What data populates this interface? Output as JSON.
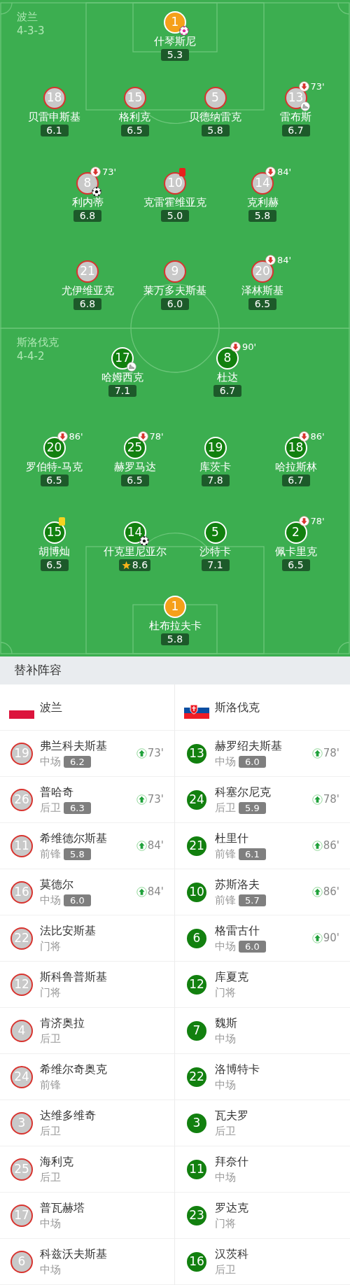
{
  "pitch": {
    "teams": [
      {
        "name": "波兰",
        "formation": "4-3-3",
        "kind": "home",
        "lines": [
          [
            {
              "number": "1",
              "name": "什琴斯尼",
              "rating": "5.3",
              "kind": "goalkeeper",
              "best": false,
              "events": [
                {
                  "kind": "own_goal"
                }
              ]
            }
          ],
          [
            {
              "number": "18",
              "name": "贝雷申斯基",
              "rating": "6.1",
              "kind": "outfield",
              "best": false
            },
            {
              "number": "15",
              "name": "格利克",
              "rating": "6.5",
              "kind": "outfield",
              "best": false
            },
            {
              "number": "5",
              "name": "贝德纳雷克",
              "rating": "5.8",
              "kind": "outfield",
              "best": false
            },
            {
              "number": "13",
              "name": "雷布斯",
              "rating": "6.7",
              "kind": "outfield",
              "best": false,
              "events": [
                {
                  "kind": "sub_off",
                  "minute": "73'"
                },
                {
                  "kind": "assist"
                }
              ]
            }
          ],
          [
            {
              "number": "8",
              "name": "利内蒂",
              "rating": "6.8",
              "kind": "outfield",
              "best": false,
              "events": [
                {
                  "kind": "sub_off",
                  "minute": "73'"
                },
                {
                  "kind": "goal"
                }
              ]
            },
            {
              "number": "10",
              "name": "克雷霍维亚克",
              "rating": "5.0",
              "kind": "outfield",
              "best": false,
              "events": [
                {
                  "kind": "red_card"
                }
              ]
            },
            {
              "number": "14",
              "name": "克利赫",
              "rating": "5.8",
              "kind": "outfield",
              "best": false,
              "events": [
                {
                  "kind": "sub_off",
                  "minute": "84'"
                }
              ]
            }
          ],
          [
            {
              "number": "21",
              "name": "尤伊维亚克",
              "rating": "6.8",
              "kind": "outfield",
              "best": false
            },
            {
              "number": "9",
              "name": "莱万多夫斯基",
              "rating": "6.0",
              "kind": "outfield",
              "best": false
            },
            {
              "number": "20",
              "name": "泽林斯基",
              "rating": "6.5",
              "kind": "outfield",
              "best": false,
              "events": [
                {
                  "kind": "sub_off",
                  "minute": "84'"
                }
              ]
            }
          ]
        ]
      },
      {
        "name": "斯洛伐克",
        "formation": "4-4-2",
        "kind": "away",
        "lines": [
          [
            {
              "number": "17",
              "name": "哈姆西克",
              "rating": "7.1",
              "kind": "outfield",
              "best": false,
              "events": [
                {
                  "kind": "assist"
                }
              ]
            },
            {
              "number": "8",
              "name": "杜达",
              "rating": "6.7",
              "kind": "outfield",
              "best": false,
              "events": [
                {
                  "kind": "sub_off",
                  "minute": "90'"
                }
              ]
            }
          ],
          [
            {
              "number": "20",
              "name": "罗伯特-马克",
              "rating": "6.5",
              "kind": "outfield",
              "best": false,
              "events": [
                {
                  "kind": "sub_off",
                  "minute": "86'"
                }
              ]
            },
            {
              "number": "25",
              "name": "赫罗马达",
              "rating": "6.5",
              "kind": "outfield",
              "best": false,
              "events": [
                {
                  "kind": "sub_off",
                  "minute": "78'"
                }
              ]
            },
            {
              "number": "19",
              "name": "库茨卡",
              "rating": "7.8",
              "kind": "outfield",
              "best": false
            },
            {
              "number": "18",
              "name": "哈拉斯林",
              "rating": "6.7",
              "kind": "outfield",
              "best": false,
              "events": [
                {
                  "kind": "sub_off",
                  "minute": "86'"
                }
              ]
            }
          ],
          [
            {
              "number": "15",
              "name": "胡博灿",
              "rating": "6.5",
              "kind": "outfield",
              "best": false,
              "events": [
                {
                  "kind": "yellow_card"
                }
              ]
            },
            {
              "number": "14",
              "name": "什克里尼亚尔",
              "rating": "8.6",
              "kind": "outfield",
              "best": true,
              "events": [
                {
                  "kind": "goal"
                }
              ]
            },
            {
              "number": "5",
              "name": "沙特卡",
              "rating": "7.1",
              "kind": "outfield",
              "best": false
            },
            {
              "number": "2",
              "name": "佩卡里克",
              "rating": "6.5",
              "kind": "outfield",
              "best": false,
              "events": [
                {
                  "kind": "sub_off",
                  "minute": "78'"
                }
              ]
            }
          ],
          [
            {
              "number": "1",
              "name": "杜布拉夫卡",
              "rating": "5.8",
              "kind": "goalkeeper",
              "best": false
            }
          ]
        ]
      }
    ]
  },
  "substitutes": {
    "title": "替补阵容",
    "teams": [
      {
        "name": "波兰",
        "kind": "poland",
        "players": [
          {
            "number": "19",
            "name": "弗兰科夫斯基",
            "position": "中场",
            "rating": "6.2",
            "sub_on": "73'"
          },
          {
            "number": "26",
            "name": "普哈奇",
            "position": "后卫",
            "rating": "6.3",
            "sub_on": "73'"
          },
          {
            "number": "11",
            "name": "希维德尔斯基",
            "position": "前锋",
            "rating": "5.8",
            "sub_on": "84'"
          },
          {
            "number": "16",
            "name": "莫德尔",
            "position": "中场",
            "rating": "6.0",
            "sub_on": "84'"
          },
          {
            "number": "22",
            "name": "法比安斯基",
            "position": "门将"
          },
          {
            "number": "12",
            "name": "斯科鲁普斯基",
            "position": "门将"
          },
          {
            "number": "4",
            "name": "肯济奥拉",
            "position": "后卫"
          },
          {
            "number": "24",
            "name": "希维尔奇奥克",
            "position": "前锋"
          },
          {
            "number": "3",
            "name": "达维多维奇",
            "position": "后卫"
          },
          {
            "number": "25",
            "name": "海利克",
            "position": "后卫"
          },
          {
            "number": "17",
            "name": "普瓦赫塔",
            "position": "中场"
          },
          {
            "number": "6",
            "name": "科兹沃夫斯基",
            "position": "中场"
          }
        ]
      },
      {
        "name": "斯洛伐克",
        "kind": "slovakia",
        "players": [
          {
            "number": "13",
            "name": "赫罗绍夫斯基",
            "position": "中场",
            "rating": "6.0",
            "sub_on": "78'"
          },
          {
            "number": "24",
            "name": "科塞尔尼克",
            "position": "后卫",
            "rating": "5.9",
            "sub_on": "78'"
          },
          {
            "number": "21",
            "name": "杜里什",
            "position": "前锋",
            "rating": "6.1",
            "sub_on": "86'"
          },
          {
            "number": "10",
            "name": "苏斯洛夫",
            "position": "前锋",
            "rating": "5.7",
            "sub_on": "86'"
          },
          {
            "number": "6",
            "name": "格雷古什",
            "position": "中场",
            "rating": "6.0",
            "sub_on": "90'"
          },
          {
            "number": "12",
            "name": "库夏克",
            "position": "门将"
          },
          {
            "number": "7",
            "name": "魏斯",
            "position": "中场"
          },
          {
            "number": "22",
            "name": "洛博特卡",
            "position": "中场"
          },
          {
            "number": "3",
            "name": "瓦夫罗",
            "position": "后卫"
          },
          {
            "number": "11",
            "name": "拜奈什",
            "position": "中场"
          },
          {
            "number": "23",
            "name": "罗达克",
            "position": "门将"
          },
          {
            "number": "16",
            "name": "汉茨科",
            "position": "后卫"
          }
        ]
      }
    ]
  }
}
